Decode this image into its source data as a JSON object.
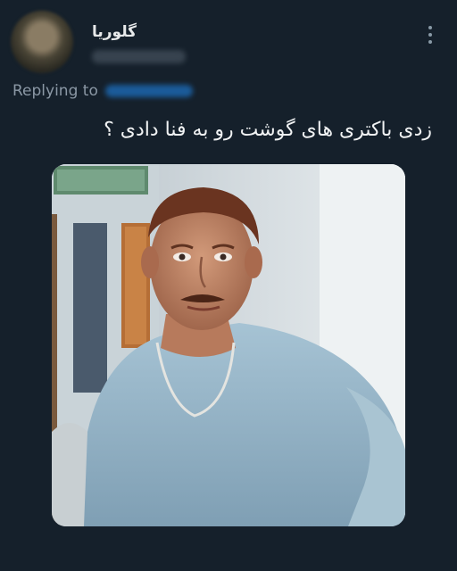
{
  "tweet": {
    "author": {
      "name": "گلوریا"
    },
    "replying_label": "Replying to",
    "text": "زدی باکتری های گوشت رو به فنا دادی ؟",
    "media": {
      "icon": "photo"
    }
  },
  "icons": {
    "more": "more-options-icon"
  },
  "colors": {
    "background": "#15202b",
    "text_primary": "#e7e9ea",
    "text_secondary": "#8b98a5",
    "link": "#1d9bf0"
  }
}
